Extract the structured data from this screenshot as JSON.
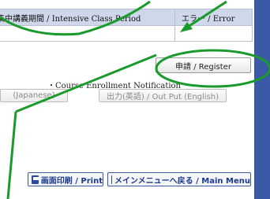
{
  "table": {
    "period_header": "集中講義期間 / Intensive Class Period",
    "error_header": "エラー / Error"
  },
  "register_button": "申請 / Register",
  "notification_label": "・Course Enrollment Notification",
  "output_japanese_button": "(Japanese)",
  "output_english_button": "出力(英語) / Out Put (English)",
  "footer": {
    "print_label": "画面印刷 / Print",
    "main_menu_label": "メインメニューへ戻る / Main Menu"
  },
  "colors": {
    "annotation_green": "#1a9a2a",
    "accent_blue": "#3c59a8"
  },
  "icons": [
    "printer-icon",
    "return-icon"
  ]
}
